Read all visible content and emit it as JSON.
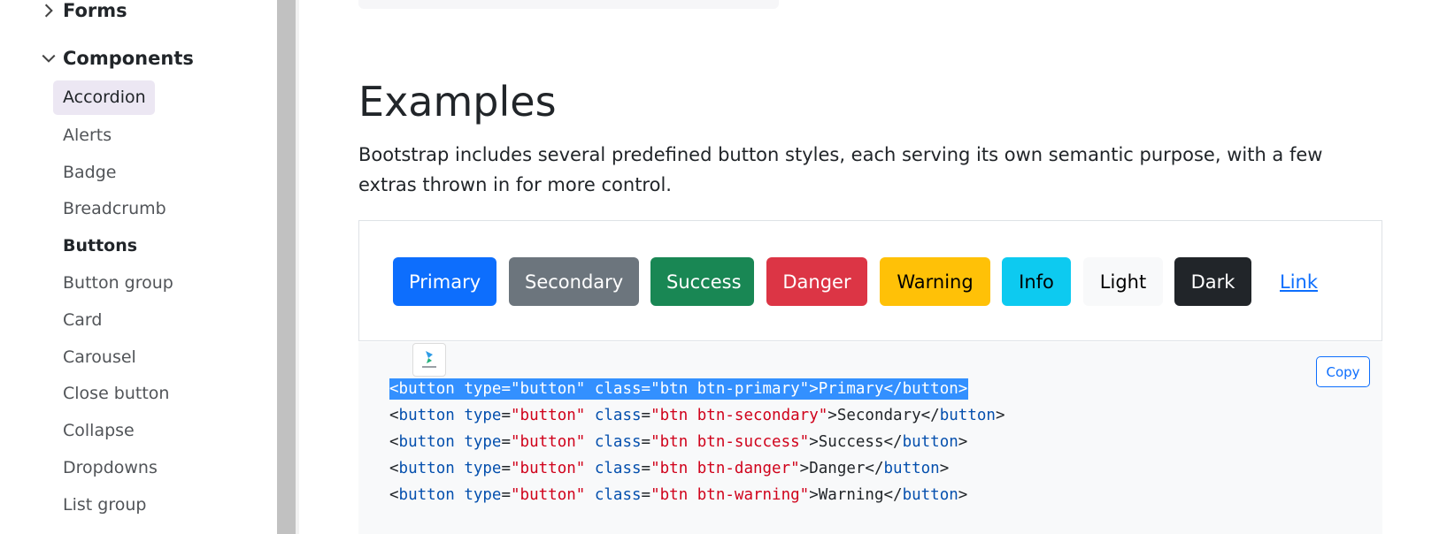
{
  "sidebar": {
    "groups": [
      {
        "label": "Forms",
        "expanded": false
      },
      {
        "label": "Components",
        "expanded": true
      }
    ],
    "items": [
      {
        "label": "Accordion"
      },
      {
        "label": "Alerts"
      },
      {
        "label": "Badge"
      },
      {
        "label": "Breadcrumb"
      },
      {
        "label": "Buttons"
      },
      {
        "label": "Button group"
      },
      {
        "label": "Card"
      },
      {
        "label": "Carousel"
      },
      {
        "label": "Close button"
      },
      {
        "label": "Collapse"
      },
      {
        "label": "Dropdowns"
      },
      {
        "label": "List group"
      }
    ]
  },
  "main": {
    "title": "Examples",
    "description": "Bootstrap includes several predefined button styles, each serving its own semantic purpose, with a few extras thrown in for more control.",
    "buttons": [
      {
        "label": "Primary",
        "bg": "#0d6efd",
        "color": "#ffffff"
      },
      {
        "label": "Secondary",
        "bg": "#6c757d",
        "color": "#ffffff"
      },
      {
        "label": "Success",
        "bg": "#198754",
        "color": "#ffffff"
      },
      {
        "label": "Danger",
        "bg": "#dc3545",
        "color": "#ffffff"
      },
      {
        "label": "Warning",
        "bg": "#ffc107",
        "color": "#000000"
      },
      {
        "label": "Info",
        "bg": "#0dcaf0",
        "color": "#000000"
      },
      {
        "label": "Light",
        "bg": "#f8f9fa",
        "color": "#000000"
      },
      {
        "label": "Dark",
        "bg": "#212529",
        "color": "#ffffff"
      },
      {
        "label": "Link",
        "bg": "transparent",
        "color": "#0d6efd"
      }
    ],
    "copy_label": "Copy",
    "plugin_icon": "extension-icon",
    "code_lines": [
      {
        "attr_type": "button",
        "attr_class": "btn btn-primary",
        "text": "Primary",
        "selected": true
      },
      {
        "attr_type": "button",
        "attr_class": "btn btn-secondary",
        "text": "Secondary",
        "selected": false
      },
      {
        "attr_type": "button",
        "attr_class": "btn btn-success",
        "text": "Success",
        "selected": false
      },
      {
        "attr_type": "button",
        "attr_class": "btn btn-danger",
        "text": "Danger",
        "selected": false
      },
      {
        "attr_type": "button",
        "attr_class": "btn btn-warning",
        "text": "Warning",
        "selected": false
      }
    ]
  }
}
